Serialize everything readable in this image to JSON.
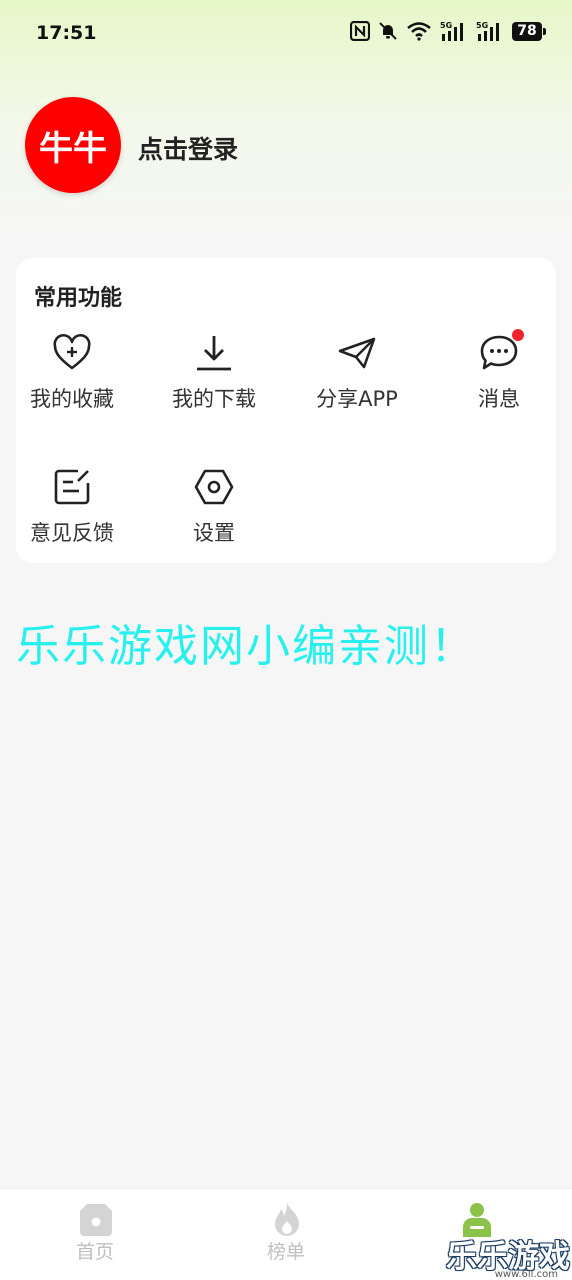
{
  "status_bar": {
    "time": "17:51",
    "network_1": "5G",
    "network_2": "5G",
    "battery": "78"
  },
  "profile": {
    "avatar_text": "牛牛",
    "avatar_color": "#ff0000",
    "login_label": "点击登录"
  },
  "common_functions": {
    "title": "常用功能",
    "items": [
      {
        "label": "我的收藏",
        "icon": "heart-plus-icon"
      },
      {
        "label": "我的下载",
        "icon": "download-icon"
      },
      {
        "label": "分享APP",
        "icon": "paper-plane-icon"
      },
      {
        "label": "消息",
        "icon": "chat-bubble-icon",
        "badge": true
      },
      {
        "label": "意见反馈",
        "icon": "feedback-edit-icon"
      },
      {
        "label": "设置",
        "icon": "settings-hex-icon"
      }
    ]
  },
  "promo_text": "乐乐游戏网小编亲测！",
  "bottom_nav": {
    "items": [
      {
        "label": "首页",
        "icon": "home-icon",
        "active": false
      },
      {
        "label": "榜单",
        "icon": "flame-icon",
        "active": false
      },
      {
        "label": "",
        "icon": "person-icon",
        "active": true
      }
    ]
  },
  "watermark": {
    "logo_text": "乐乐游戏",
    "url": "www.6ll.com"
  },
  "colors": {
    "accent_green": "#8bc34a",
    "badge_red": "#f2222f",
    "promo_cyan": "#27f0ef",
    "nav_inactive": "#c0c0c0"
  }
}
